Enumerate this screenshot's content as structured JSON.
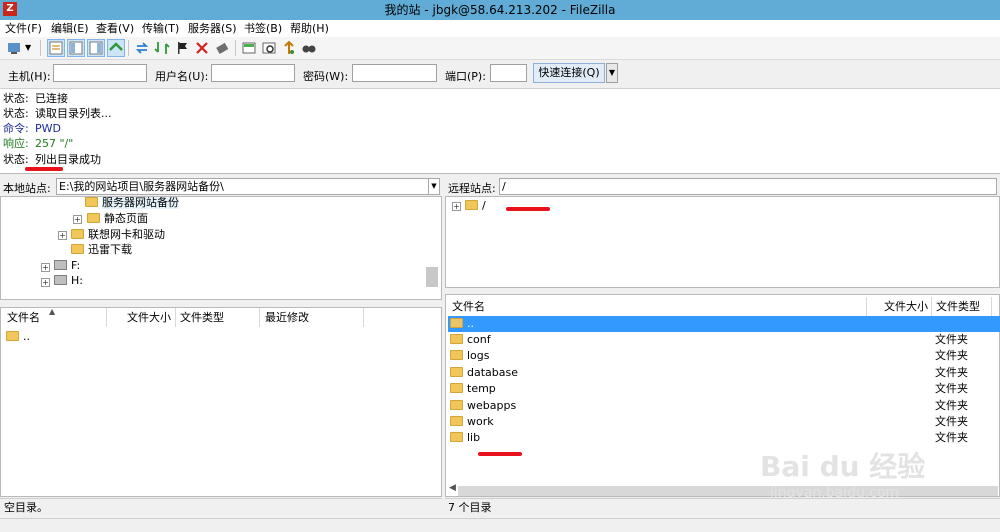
{
  "window": {
    "title": "我的站 - jbgk@58.64.213.202 - FileZilla"
  },
  "menu": [
    {
      "label": "文件(F)"
    },
    {
      "label": "编辑(E)"
    },
    {
      "label": "查看(V)"
    },
    {
      "label": "传输(T)"
    },
    {
      "label": "服务器(S)"
    },
    {
      "label": "书签(B)"
    },
    {
      "label": "帮助(H)"
    }
  ],
  "quickconnect": {
    "host_label": "主机(H):",
    "user_label": "用户名(U):",
    "pass_label": "密码(W):",
    "port_label": "端口(P):",
    "host": "",
    "user": "",
    "pass": "",
    "port": "",
    "button": "快速连接(Q)"
  },
  "log": [
    {
      "key": "状态:",
      "text": "已连接",
      "type": "status"
    },
    {
      "key": "状态:",
      "text": "读取目录列表...",
      "type": "status"
    },
    {
      "key": "命令:",
      "text": "PWD",
      "type": "cmd"
    },
    {
      "key": "响应:",
      "text": "257 \"/\"",
      "type": "resp"
    },
    {
      "key": "状态:",
      "text": "列出目录成功",
      "type": "status"
    }
  ],
  "local": {
    "label": "本地站点:",
    "path": "E:\\我的网站项目\\服务器网站备份\\",
    "tree": [
      {
        "label": "服务器网站备份",
        "icon": "folder"
      },
      {
        "label": "静态页面",
        "icon": "folder"
      },
      {
        "label": "联想网卡和驱动",
        "icon": "folder"
      },
      {
        "label": "迅雷下载",
        "icon": "folder"
      },
      {
        "label": "F:",
        "icon": "drive"
      },
      {
        "label": "H:",
        "icon": "drive"
      }
    ],
    "columns": {
      "name": "文件名",
      "size": "文件大小",
      "type": "文件类型",
      "modified": "最近修改"
    },
    "files": [
      {
        "name": ".."
      }
    ],
    "status": "空目录。"
  },
  "remote": {
    "label": "远程站点:",
    "path": "/",
    "tree": [
      {
        "label": "/",
        "icon": "folder"
      }
    ],
    "columns": {
      "name": "文件名",
      "size": "文件大小",
      "type": "文件类型"
    },
    "files": [
      {
        "name": "..",
        "type": ""
      },
      {
        "name": "conf",
        "type": "文件夹"
      },
      {
        "name": "logs",
        "type": "文件夹"
      },
      {
        "name": "database",
        "type": "文件夹"
      },
      {
        "name": "temp",
        "type": "文件夹"
      },
      {
        "name": "webapps",
        "type": "文件夹"
      },
      {
        "name": "work",
        "type": "文件夹"
      },
      {
        "name": "lib",
        "type": "文件夹"
      }
    ],
    "status": "7 个目录"
  },
  "watermark": {
    "line1": "Bai du 经验",
    "line2": "jingyan.baidu.com"
  },
  "colors": {
    "titlebar": "#60acd6",
    "selection": "#3399ff",
    "annotation": "#e8121c"
  }
}
